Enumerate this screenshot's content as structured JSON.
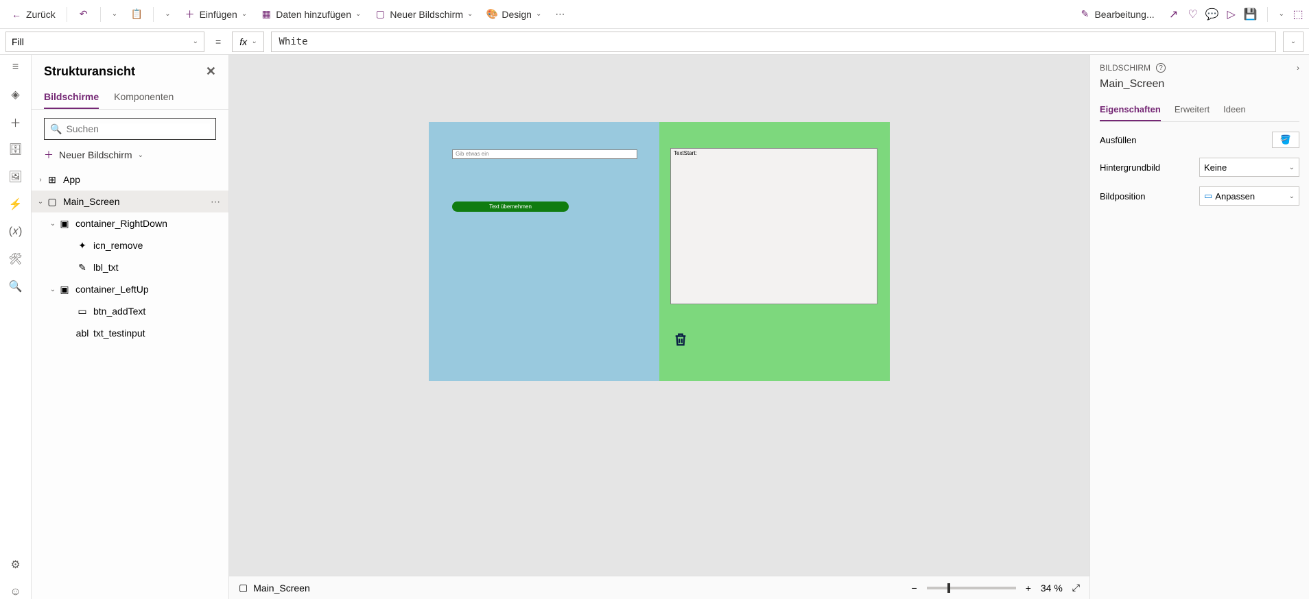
{
  "toolbar": {
    "back": "Zurück",
    "insert": "Einfügen",
    "add_data": "Daten hinzufügen",
    "new_screen": "Neuer Bildschirm",
    "design": "Design",
    "edit": "Bearbeitung..."
  },
  "formula": {
    "property": "Fill",
    "fx": "fx",
    "value": "White"
  },
  "tree": {
    "title": "Strukturansicht",
    "tab_screens": "Bildschirme",
    "tab_components": "Komponenten",
    "search_placeholder": "Suchen",
    "new_screen": "Neuer Bildschirm",
    "items": {
      "app": "App",
      "main_screen": "Main_Screen",
      "container_right": "container_RightDown",
      "icn_remove": "icn_remove",
      "lbl_txt": "lbl_txt",
      "container_left": "container_LeftUp",
      "btn_addText": "btn_addText",
      "txt_testinput": "txt_testinput"
    }
  },
  "canvas": {
    "input_placeholder": "Gib etwas ein",
    "button_text": "Text übernehmen",
    "label_text": "TextStart:"
  },
  "footer": {
    "screen": "Main_Screen",
    "zoom_value": "34",
    "zoom_unit": "%"
  },
  "props": {
    "category": "BILDSCHIRM",
    "name": "Main_Screen",
    "tab_properties": "Eigenschaften",
    "tab_advanced": "Erweitert",
    "tab_ideas": "Ideen",
    "fill_label": "Ausfüllen",
    "bg_image_label": "Hintergrundbild",
    "bg_image_value": "Keine",
    "img_pos_label": "Bildposition",
    "img_pos_value": "Anpassen"
  }
}
